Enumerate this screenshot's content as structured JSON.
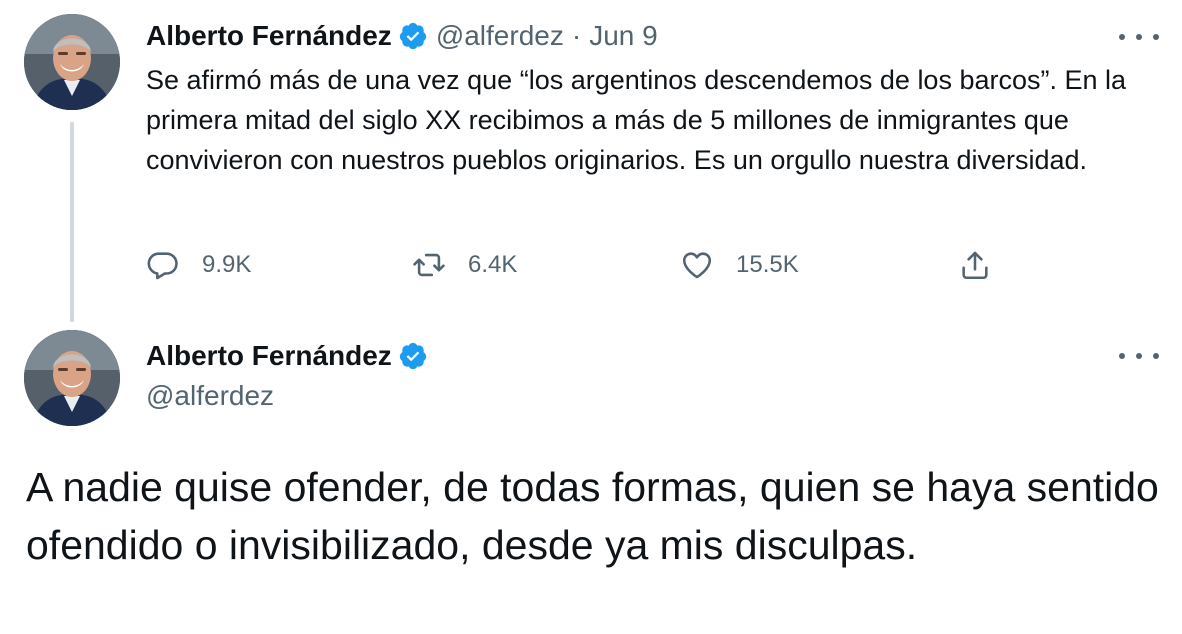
{
  "tweet1": {
    "author": {
      "name": "Alberto Fernández",
      "handle": "@alferdez"
    },
    "separator": "·",
    "date": "Jun 9",
    "text": "Se afirmó más de una vez que “los argentinos descendemos de los barcos”. En la primera mitad del siglo XX recibimos a más de 5 millones de inmigrantes que convivieron con nuestros pueblos originarios. Es un orgullo nuestra diversidad.",
    "actions": {
      "reply_count": "9.9K",
      "retweet_count": "6.4K",
      "like_count": "15.5K"
    }
  },
  "tweet2": {
    "author": {
      "name": "Alberto Fernández",
      "handle": "@alferdez"
    },
    "text": "A nadie quise ofender, de todas formas, quien se haya sentido ofendido o invisibilizado, desde ya mis disculpas."
  },
  "icons": {
    "verified": "verified-badge-icon",
    "more": "more-options-icon",
    "reply": "reply-icon",
    "retweet": "retweet-icon",
    "like": "heart-icon",
    "share": "share-icon"
  },
  "colors": {
    "text": "#0f1419",
    "muted": "#536471",
    "verified": "#1d9bf0",
    "thread_line": "#cfd9de"
  }
}
